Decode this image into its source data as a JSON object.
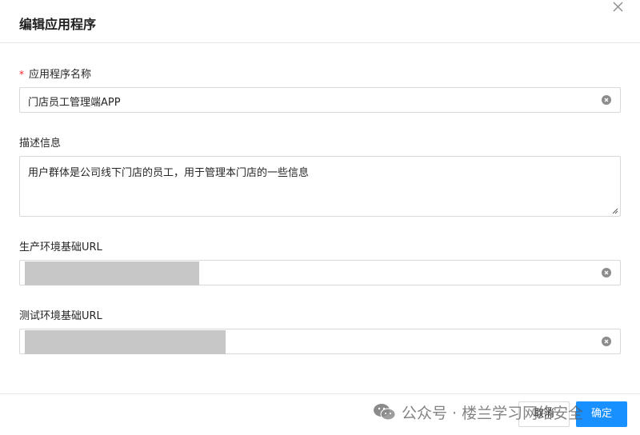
{
  "dialog": {
    "title": "编辑应用程序",
    "close_icon": "close-icon"
  },
  "form": {
    "app_name": {
      "required_mark": "*",
      "label": "应用程序名称",
      "value": "门店员工管理端APP"
    },
    "description": {
      "label": "描述信息",
      "value": "用户群体是公司线下门店的员工，用于管理本门店的一些信息"
    },
    "prod_url": {
      "label": "生产环境基础URL",
      "value": ""
    },
    "test_url": {
      "label": "测试环境基础URL",
      "value": ""
    }
  },
  "footer": {
    "cancel_label": "取消",
    "ok_label": "确定"
  },
  "watermark": {
    "text": "公众号 · 楼兰学习网络安全",
    "icon": "wechat-icon"
  },
  "colors": {
    "primary": "#1890ff",
    "required": "#f5222d",
    "border": "#d9d9d9"
  }
}
